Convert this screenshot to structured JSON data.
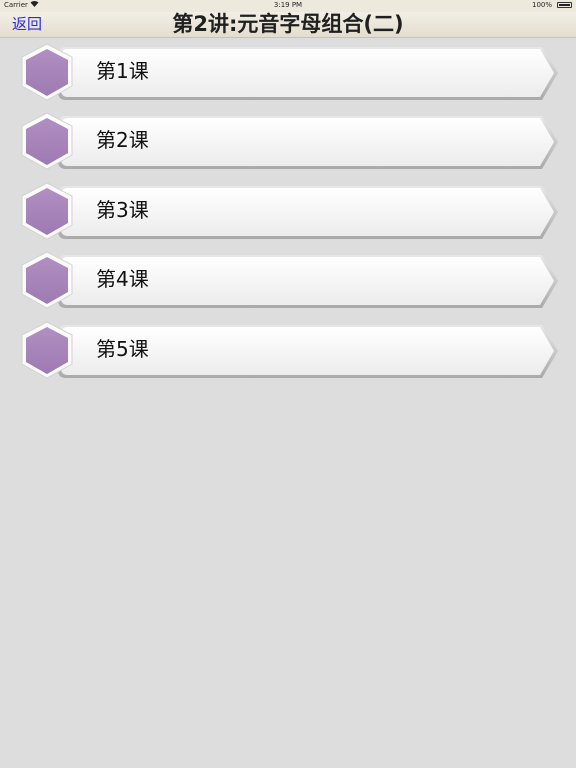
{
  "status_bar": {
    "carrier": "Carrier",
    "time": "3:19 PM",
    "battery": "100%"
  },
  "nav": {
    "back_label": "返回",
    "title": "第2讲:元音字母组合(二)"
  },
  "lessons": [
    {
      "label": "第1课"
    },
    {
      "label": "第2课"
    },
    {
      "label": "第3课"
    },
    {
      "label": "第4课"
    },
    {
      "label": "第5课"
    }
  ],
  "colors": {
    "background": "#dcdddc",
    "hexagon": "#a783ba",
    "back_link": "#2a2adb"
  }
}
